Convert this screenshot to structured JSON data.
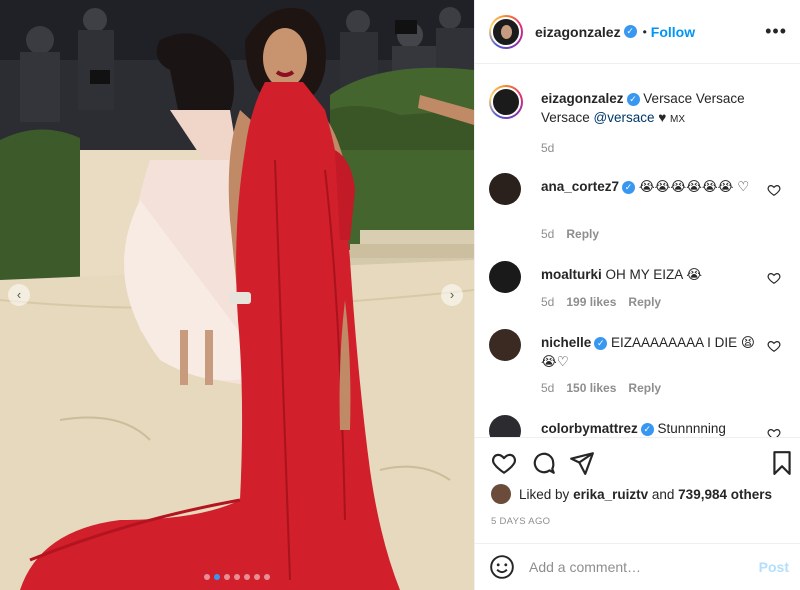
{
  "post": {
    "username": "eizagonzalez",
    "follow_label": "Follow",
    "separator": "•",
    "more_label": "•••"
  },
  "caption": {
    "username": "eizagonzalez",
    "text_before": "Versace Versace Versace ",
    "mention": "@versace",
    "text_after": " ♥ ",
    "flag": "MX",
    "age": "5d"
  },
  "comments": [
    {
      "username": "ana_cortez7",
      "verified": true,
      "text": "😭😭😭😭😭😭 ♡",
      "age": "5d",
      "likes": "",
      "reply": "Reply"
    },
    {
      "username": "moalturki",
      "verified": false,
      "text": "OH MY EIZA 😭",
      "age": "5d",
      "likes": "199 likes",
      "reply": "Reply"
    },
    {
      "username": "nichelle",
      "verified": true,
      "text": "EIZAAAAAAAA I DIE 😫 😭♡",
      "age": "5d",
      "likes": "150 likes",
      "reply": "Reply"
    },
    {
      "username": "colorbymattrez",
      "verified": true,
      "text": "Stunnnning",
      "age": "",
      "likes": "",
      "reply": ""
    }
  ],
  "engagement": {
    "liked_by_prefix": "Liked by ",
    "liked_by_user": "erika_ruiztv",
    "and_label": " and ",
    "others": "739,984 others",
    "timestamp": "5 DAYS AGO"
  },
  "add_comment": {
    "placeholder": "Add a comment…",
    "post_label": "Post"
  },
  "carousel": {
    "prev_label": "‹",
    "next_label": "›",
    "total_slides": 7,
    "active_slide": 1
  },
  "icons": {
    "verified": "✓",
    "like": "heart-icon",
    "comment": "comment-icon",
    "share": "share-icon",
    "save": "bookmark-icon",
    "emoji": "emoji-icon"
  },
  "colors": {
    "accent": "#0095f6",
    "verified": "#3897f0",
    "dress": "#d11f2b",
    "muted": "#8e8e8e"
  }
}
